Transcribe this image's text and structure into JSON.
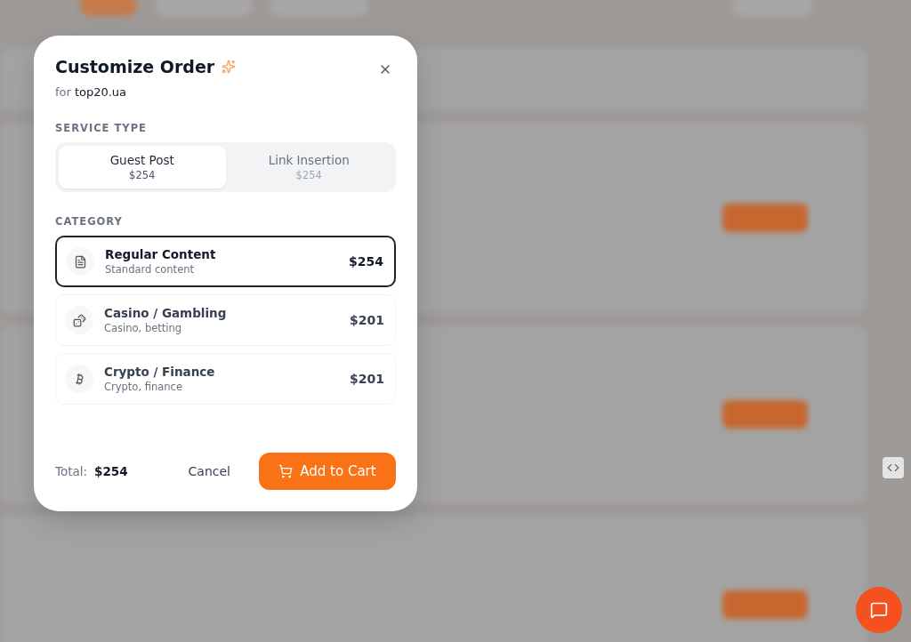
{
  "modal": {
    "title": "Customize Order",
    "subtitle_prefix": "for",
    "domain": "top20.ua",
    "service_type_label": "SERVICE TYPE",
    "service_types": [
      {
        "label": "Guest Post",
        "price": "$254",
        "selected": true
      },
      {
        "label": "Link Insertion",
        "price": "$254",
        "selected": false
      }
    ],
    "category_label": "CATEGORY",
    "categories": [
      {
        "kind": "document",
        "name": "Regular Content",
        "description": "Standard content",
        "price": "$254",
        "selected": true
      },
      {
        "kind": "dice",
        "name": "Casino / Gambling",
        "description": "Casino, betting",
        "price": "$201",
        "selected": false
      },
      {
        "kind": "bitcoin",
        "name": "Crypto / Finance",
        "description": "Crypto, finance",
        "price": "$201",
        "selected": false
      }
    ],
    "total_label": "Total:",
    "total": "$254",
    "cancel": "Cancel",
    "add_to_cart": "Add to Cart"
  }
}
